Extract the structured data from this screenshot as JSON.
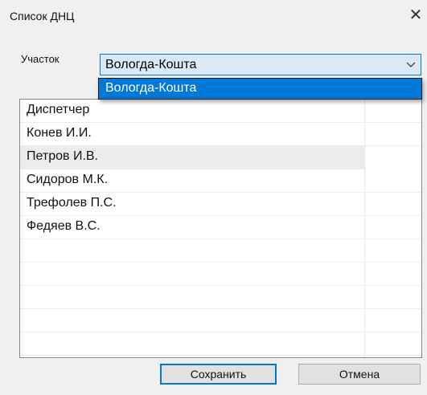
{
  "window": {
    "title": "Список ДНЦ",
    "close_symbol": "✕"
  },
  "form": {
    "section_label": "Участок",
    "combo": {
      "selected": "Вологда-Кошта",
      "arrow_icon": "chevron-down-icon"
    },
    "dropdown_options": [
      "Вологда-Кошта"
    ]
  },
  "list": {
    "items": [
      "Диспетчер",
      "Конев И.И.",
      "Петров И.В.",
      "Сидоров М.К.",
      "Трефолев П.С.",
      "Федяев В.С."
    ],
    "selected_index": 2
  },
  "buttons": {
    "save": "Сохранить",
    "cancel": "Отмена"
  }
}
